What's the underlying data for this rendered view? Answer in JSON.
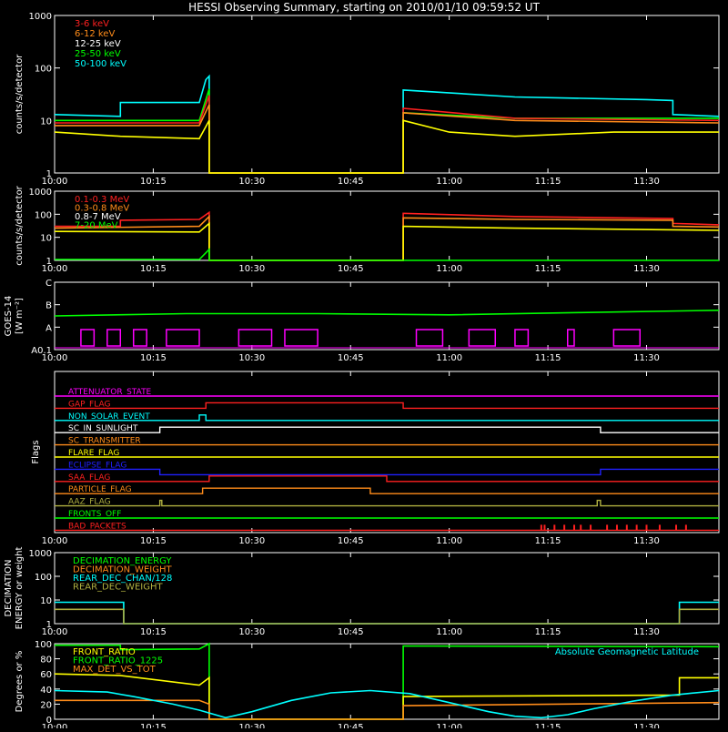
{
  "title": "HESSI Observing Summary, starting on 2010/01/10 09:59:52 UT",
  "time_ticks": [
    "10:00",
    "10:15",
    "10:30",
    "10:45",
    "11:00",
    "11:15",
    "11:30"
  ],
  "colors": {
    "white": "#ffffff",
    "red": "#ff2020",
    "orange": "#ff8c1a",
    "yellow": "#ffff00",
    "green": "#00ff00",
    "cyan": "#00ffff",
    "magenta": "#ff00ff",
    "blue": "#2020ff",
    "olive": "#b0b040",
    "lime": "#33ff33"
  },
  "chart_data": [
    {
      "id": "rates_low",
      "type": "line",
      "ylabel": "counts/s/detector",
      "yscale": "log",
      "ylim": [
        1,
        1000
      ],
      "ytick_labels": [
        "1",
        "10",
        "100",
        "1000"
      ],
      "x_range_minutes": [
        0,
        101
      ],
      "legend": [
        {
          "name": "3-6 keV",
          "color": "red"
        },
        {
          "name": "6-12 keV",
          "color": "orange"
        },
        {
          "name": "12-25 keV",
          "color": "white"
        },
        {
          "name": "25-50 keV",
          "color": "green"
        },
        {
          "name": "50-100 keV",
          "color": "cyan"
        }
      ],
      "series": [
        {
          "name": "50-100 keV",
          "color": "cyan",
          "points": [
            [
              0,
              13
            ],
            [
              10,
              12
            ],
            [
              10,
              22
            ],
            [
              22,
              22
            ],
            [
              23,
              60
            ],
            [
              23.5,
              70
            ],
            [
              23.5,
              1
            ],
            [
              53,
              1
            ],
            [
              53,
              38
            ],
            [
              70,
              28
            ],
            [
              90,
              25
            ],
            [
              94,
              24
            ],
            [
              94,
              13
            ],
            [
              101,
              12
            ]
          ]
        },
        {
          "name": "25-50 keV",
          "color": "green",
          "points": [
            [
              0,
              10
            ],
            [
              22,
              10
            ],
            [
              23.5,
              40
            ],
            [
              23.5,
              1
            ],
            [
              53,
              1
            ],
            [
              53,
              14
            ],
            [
              70,
              11
            ],
            [
              101,
              11
            ]
          ]
        },
        {
          "name": "3-6 keV",
          "color": "red",
          "points": [
            [
              0,
              9
            ],
            [
              22,
              9
            ],
            [
              23.5,
              30
            ],
            [
              23.5,
              1
            ],
            [
              53,
              1
            ],
            [
              53,
              17
            ],
            [
              70,
              11
            ],
            [
              101,
              10
            ]
          ]
        },
        {
          "name": "6-12 keV",
          "color": "orange",
          "points": [
            [
              0,
              8
            ],
            [
              22,
              8
            ],
            [
              23.5,
              20
            ],
            [
              23.5,
              1
            ],
            [
              53,
              1
            ],
            [
              53,
              14
            ],
            [
              70,
              10
            ],
            [
              101,
              9
            ]
          ]
        },
        {
          "name": "12-25 keV",
          "color": "yellow",
          "points": [
            [
              0,
              6
            ],
            [
              10,
              5
            ],
            [
              22,
              4.5
            ],
            [
              23.5,
              10
            ],
            [
              23.5,
              1
            ],
            [
              53,
              1
            ],
            [
              53,
              10
            ],
            [
              60,
              6
            ],
            [
              70,
              5
            ],
            [
              85,
              6
            ],
            [
              101,
              6
            ]
          ]
        }
      ]
    },
    {
      "id": "rates_high",
      "type": "line",
      "ylabel": "counts/s/detector",
      "yscale": "log",
      "ylim": [
        1,
        1000
      ],
      "ytick_labels": [
        "1",
        "10",
        "100",
        "1000"
      ],
      "x_range_minutes": [
        0,
        101
      ],
      "legend": [
        {
          "name": "0.1-0.3 MeV",
          "color": "red"
        },
        {
          "name": "0.3-0.8 MeV",
          "color": "orange"
        },
        {
          "name": "0.8-7 MeV",
          "color": "white"
        },
        {
          "name": "7-20 MeV",
          "color": "green"
        }
      ],
      "series": [
        {
          "name": "0.1-0.3 MeV",
          "color": "red",
          "points": [
            [
              0,
              30
            ],
            [
              10,
              30
            ],
            [
              10,
              55
            ],
            [
              22,
              60
            ],
            [
              23.5,
              120
            ],
            [
              23.5,
              1
            ],
            [
              53,
              1
            ],
            [
              53,
              110
            ],
            [
              70,
              80
            ],
            [
              94,
              65
            ],
            [
              94,
              40
            ],
            [
              101,
              35
            ]
          ]
        },
        {
          "name": "0.3-0.8 MeV",
          "color": "orange",
          "points": [
            [
              0,
              25
            ],
            [
              22,
              30
            ],
            [
              23.5,
              80
            ],
            [
              23.5,
              1
            ],
            [
              53,
              1
            ],
            [
              53,
              70
            ],
            [
              70,
              60
            ],
            [
              94,
              55
            ],
            [
              94,
              30
            ],
            [
              101,
              28
            ]
          ]
        },
        {
          "name": "0.8-7 MeV",
          "color": "yellow",
          "points": [
            [
              0,
              18
            ],
            [
              22,
              17
            ],
            [
              23.5,
              40
            ],
            [
              23.5,
              1
            ],
            [
              53,
              1
            ],
            [
              53,
              30
            ],
            [
              70,
              25
            ],
            [
              101,
              20
            ]
          ]
        },
        {
          "name": "7-20 MeV",
          "color": "green",
          "points": [
            [
              0,
              1.1
            ],
            [
              22,
              1.1
            ],
            [
              23.5,
              3
            ],
            [
              23.5,
              1
            ],
            [
              101,
              1
            ]
          ]
        }
      ]
    },
    {
      "id": "goes",
      "type": "line",
      "ylabel": "GOES-14",
      "ylabel2": "[W m⁻²]",
      "ytick_labels": [
        "A0.1",
        "A",
        "B",
        "C"
      ],
      "x_range_minutes": [
        0,
        101
      ],
      "series": [
        {
          "name": "GOES",
          "color": "green",
          "points": [
            [
              0,
              1.5
            ],
            [
              20,
              1.6
            ],
            [
              40,
              1.6
            ],
            [
              60,
              1.55
            ],
            [
              80,
              1.65
            ],
            [
              101,
              1.75
            ]
          ]
        }
      ],
      "bursts": [
        [
          4,
          6
        ],
        [
          8,
          10
        ],
        [
          12,
          14
        ],
        [
          17,
          22
        ],
        [
          28,
          33
        ],
        [
          35,
          40
        ],
        [
          55,
          59
        ],
        [
          63,
          67
        ],
        [
          70,
          72
        ],
        [
          78,
          79
        ],
        [
          85,
          89
        ]
      ]
    },
    {
      "id": "flags",
      "type": "table",
      "ylabel": "Flags",
      "flags": [
        {
          "name": "ATTENUATOR_STATE",
          "color": "magenta",
          "steps": [
            [
              0,
              0
            ],
            [
              101,
              0
            ]
          ]
        },
        {
          "name": "GAP_FLAG",
          "color": "red",
          "steps": [
            [
              0,
              0
            ],
            [
              23,
              1
            ],
            [
              53,
              0
            ],
            [
              101,
              0
            ]
          ]
        },
        {
          "name": "NON_SOLAR_EVENT",
          "color": "cyan",
          "steps": [
            [
              0,
              0
            ],
            [
              22,
              1
            ],
            [
              23,
              0
            ],
            [
              101,
              0
            ]
          ]
        },
        {
          "name": "SC_IN_SUNLIGHT",
          "color": "white",
          "steps": [
            [
              0,
              0
            ],
            [
              16,
              1
            ],
            [
              83,
              0
            ],
            [
              101,
              0
            ]
          ]
        },
        {
          "name": "SC_TRANSMITTER",
          "color": "orange",
          "steps": [
            [
              0,
              0
            ],
            [
              101,
              0
            ]
          ]
        },
        {
          "name": "FLARE_FLAG",
          "color": "yellow",
          "steps": [
            [
              0,
              0
            ],
            [
              101,
              0
            ]
          ]
        },
        {
          "name": "ECLIPSE_FLAG",
          "color": "blue",
          "steps": [
            [
              0,
              0
            ],
            [
              16,
              -1
            ],
            [
              83,
              0
            ],
            [
              101,
              0
            ]
          ]
        },
        {
          "name": "SAA_FLAG",
          "color": "red",
          "steps": [
            [
              0,
              0
            ],
            [
              23.5,
              1
            ],
            [
              50.5,
              0
            ],
            [
              101,
              0
            ]
          ]
        },
        {
          "name": "PARTICLE_FLAG",
          "color": "orange",
          "steps": [
            [
              0,
              0
            ],
            [
              22.5,
              1
            ],
            [
              48,
              0
            ],
            [
              101,
              0
            ]
          ]
        },
        {
          "name": "AAZ_FLAG",
          "color": "olive",
          "steps": [
            [
              0,
              0
            ],
            [
              16,
              1
            ],
            [
              16.3,
              0
            ],
            [
              82.5,
              1
            ],
            [
              83,
              0
            ],
            [
              101,
              0
            ]
          ]
        },
        {
          "name": "FRONTS_OFF",
          "color": "green",
          "steps": [
            [
              0,
              0
            ],
            [
              101,
              0
            ]
          ]
        },
        {
          "name": "BAD_PACKETS",
          "color": "red",
          "steps": [
            [
              0,
              0
            ],
            [
              101,
              0
            ]
          ],
          "spikes": [
            74,
            74.5,
            76,
            77.5,
            79,
            80,
            81.5,
            84,
            85.5,
            87,
            88.5,
            90,
            92,
            94.5,
            96
          ]
        }
      ]
    },
    {
      "id": "decimation",
      "type": "line",
      "ylabel": "DECIMATION",
      "ylabel2": "ENERGY or weight",
      "yscale": "log",
      "ylim": [
        1,
        1000
      ],
      "ytick_labels": [
        "1",
        "10",
        "100",
        "1000"
      ],
      "x_range_minutes": [
        0,
        101
      ],
      "legend": [
        {
          "name": "DECIMATION_ENERGY",
          "color": "green"
        },
        {
          "name": "DECIMATION_WEIGHT",
          "color": "orange"
        },
        {
          "name": "REAR_DEC_CHAN/128",
          "color": "cyan"
        },
        {
          "name": "REAR_DEC_WEIGHT",
          "color": "olive"
        }
      ],
      "series": [
        {
          "name": "REAR_DEC_CHAN/128",
          "color": "cyan",
          "points": [
            [
              0,
              8
            ],
            [
              10.5,
              8
            ],
            [
              10.5,
              1
            ],
            [
              95,
              1
            ],
            [
              95,
              8
            ],
            [
              101,
              8
            ]
          ]
        },
        {
          "name": "REAR_DEC_WEIGHT",
          "color": "olive",
          "points": [
            [
              0,
              4
            ],
            [
              10.5,
              4
            ],
            [
              10.5,
              1
            ],
            [
              95,
              1
            ],
            [
              95,
              4
            ],
            [
              101,
              4
            ]
          ]
        }
      ]
    },
    {
      "id": "ratios",
      "type": "line",
      "ylabel": "Degrees or %",
      "ylim": [
        0,
        100
      ],
      "ytick_labels": [
        "0",
        "20",
        "40",
        "60",
        "80",
        "100"
      ],
      "x_range_minutes": [
        0,
        101
      ],
      "legend": [
        {
          "name": "FRONT_RATIO",
          "color": "yellow"
        },
        {
          "name": "FRONT_RATIO_1225",
          "color": "green"
        },
        {
          "name": "MAX_DET_VS_TOT",
          "color": "orange"
        }
      ],
      "annotation": "Absolute Geomagnetic Latitude",
      "series": [
        {
          "name": "FRONT_RATIO_1225",
          "color": "green",
          "points": [
            [
              0,
              98
            ],
            [
              10,
              98
            ],
            [
              10,
              92
            ],
            [
              22,
              93
            ],
            [
              23.5,
              100
            ],
            [
              23.5,
              0
            ],
            [
              53,
              0
            ],
            [
              53,
              97
            ],
            [
              101,
              96
            ]
          ]
        },
        {
          "name": "FRONT_RATIO",
          "color": "yellow",
          "points": [
            [
              0,
              60
            ],
            [
              10,
              58
            ],
            [
              22,
              45
            ],
            [
              23.5,
              55
            ],
            [
              23.5,
              0
            ],
            [
              53,
              0
            ],
            [
              53,
              30
            ],
            [
              95,
              32
            ],
            [
              95,
              55
            ],
            [
              101,
              55
            ]
          ]
        },
        {
          "name": "MAX_DET_VS_TOT",
          "color": "orange",
          "points": [
            [
              0,
              25
            ],
            [
              22,
              25
            ],
            [
              23.5,
              20
            ],
            [
              23.5,
              0
            ],
            [
              53,
              0
            ],
            [
              53,
              18
            ],
            [
              101,
              22
            ]
          ]
        },
        {
          "name": "Absolute Geomagnetic Latitude",
          "color": "cyan",
          "points": [
            [
              0,
              38
            ],
            [
              8,
              36
            ],
            [
              12,
              30
            ],
            [
              18,
              20
            ],
            [
              22,
              12
            ],
            [
              26,
              2
            ],
            [
              30,
              10
            ],
            [
              36,
              25
            ],
            [
              42,
              35
            ],
            [
              48,
              38
            ],
            [
              54,
              34
            ],
            [
              60,
              22
            ],
            [
              66,
              10
            ],
            [
              70,
              4
            ],
            [
              74,
              2
            ],
            [
              78,
              6
            ],
            [
              82,
              14
            ],
            [
              88,
              24
            ],
            [
              94,
              32
            ],
            [
              101,
              38
            ]
          ]
        }
      ]
    }
  ]
}
